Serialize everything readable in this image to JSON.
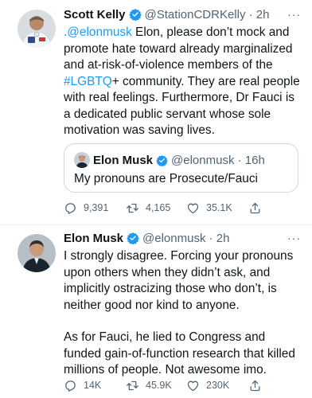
{
  "tweets": [
    {
      "name": "Scott Kelly",
      "handle_time": "@StationCDRKelly · 2h",
      "text_parts": {
        "mention": ".@elonmusk",
        "text1": " Elon, please don’t mock and promote hate toward already marginalized and at-risk-of-violence members of the ",
        "hashtag": "#LGBTQ",
        "text2": "+ community. They are real people with real feelings. Furthermore, Dr Fauci is a dedicated public servant whose sole motivation was saving lives."
      },
      "quote": {
        "name": "Elon Musk",
        "handle_time": "@elonmusk · 16h",
        "text": "My pronouns are Prosecute/Fauci"
      },
      "stats": {
        "replies": "9,391",
        "retweets": "4,165",
        "likes": "35.1K"
      }
    },
    {
      "name": "Elon Musk",
      "handle_time": "@elonmusk · 2h",
      "paragraph1": "I strongly disagree. Forcing your pronouns upon others when they didn’t ask, and implicitly ostracizing those who don’t, is neither good nor kind to anyone.",
      "paragraph2": "As for Fauci, he lied to Congress and funded gain-of-function research that killed millions of people. Not awesome imo.",
      "stats": {
        "replies": "14K",
        "retweets": "45.9K",
        "likes": "230K"
      }
    }
  ],
  "more_label": "···",
  "colors": {
    "link": "#1d9bf0",
    "secondary": "#536471",
    "verified": "#1d9bf0",
    "border": "#eff3f4"
  },
  "icons": [
    "verified-badge-icon",
    "more-icon",
    "reply-icon",
    "retweet-icon",
    "like-icon",
    "share-icon"
  ]
}
